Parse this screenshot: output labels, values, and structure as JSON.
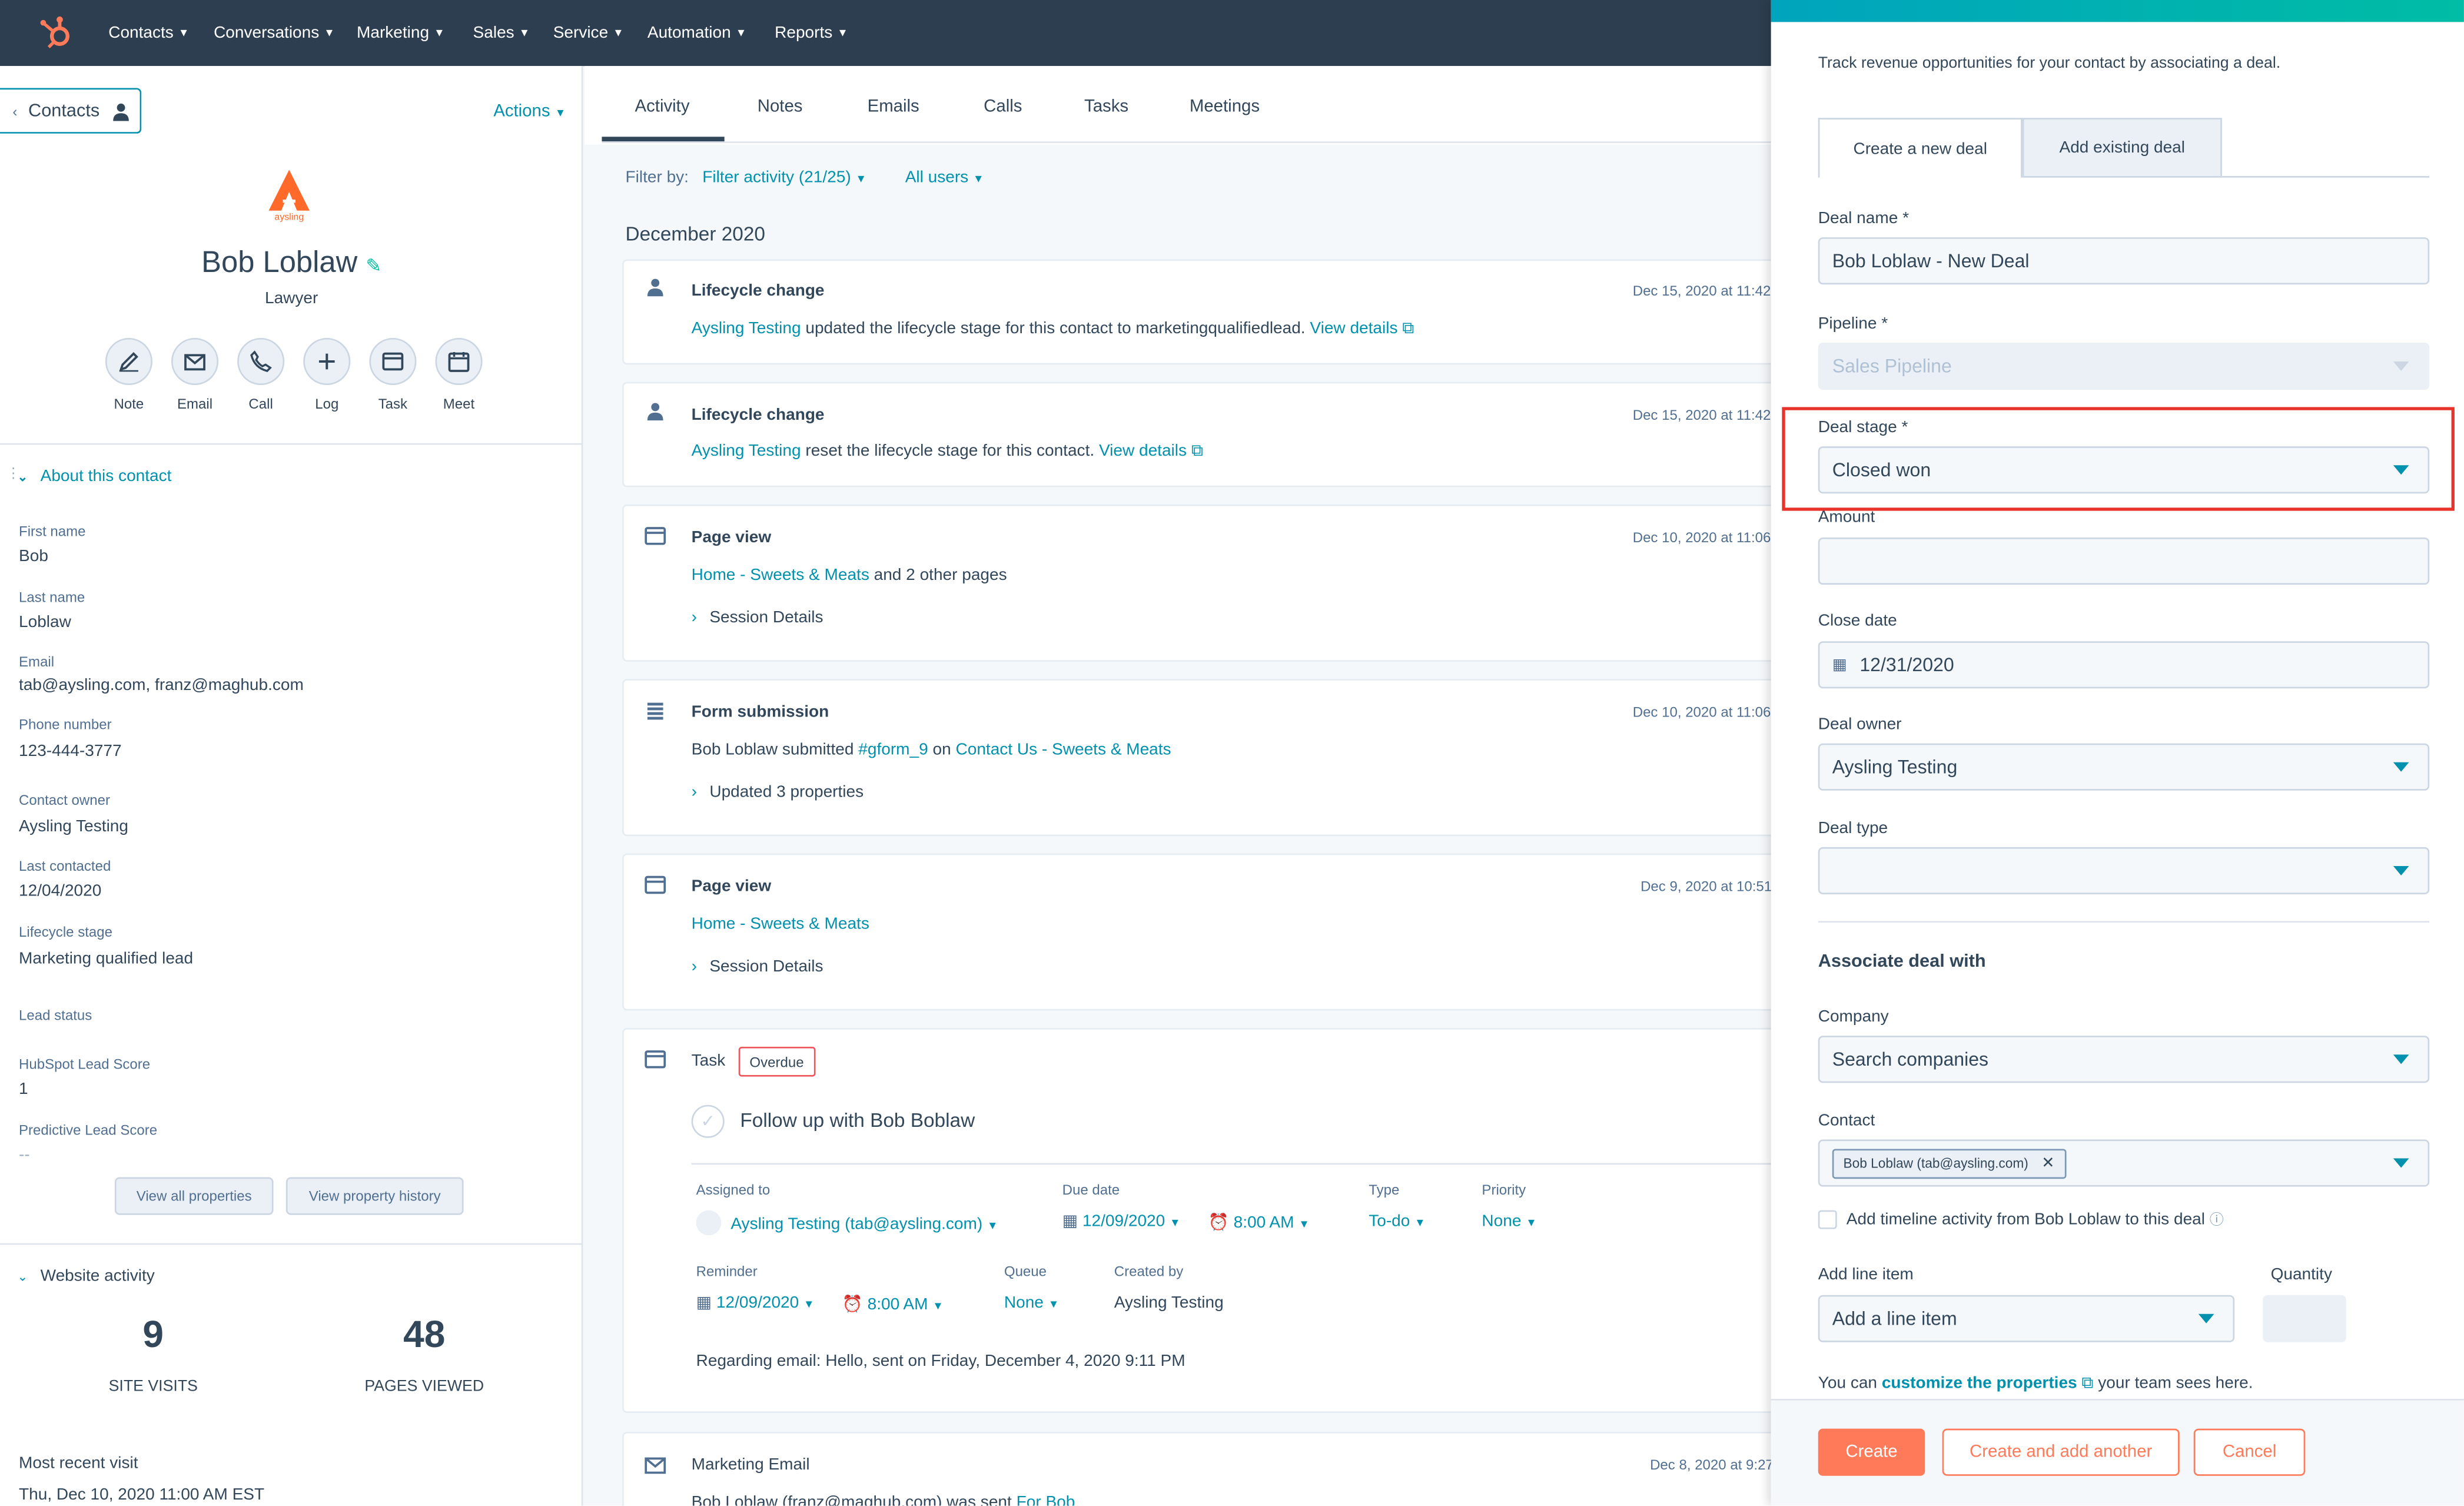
{
  "nav": {
    "items": [
      "Contacts",
      "Conversations",
      "Marketing",
      "Sales",
      "Service",
      "Automation",
      "Reports"
    ]
  },
  "contact": {
    "back_label": "Contacts",
    "actions_label": "Actions",
    "company_logo_text": "aysling",
    "name": "Bob Loblaw",
    "title": "Lawyer",
    "quick_actions": [
      "Note",
      "Email",
      "Call",
      "Log",
      "Task",
      "Meet"
    ],
    "about_header": "About this contact",
    "properties": [
      {
        "label": "First name",
        "value": "Bob"
      },
      {
        "label": "Last name",
        "value": "Loblaw"
      },
      {
        "label": "Email",
        "value": "tab@aysling.com, franz@maghub.com"
      },
      {
        "label": "Phone number",
        "value": "123-444-3777"
      },
      {
        "label": "Contact owner",
        "value": "Aysling Testing"
      },
      {
        "label": "Last contacted",
        "value": "12/04/2020"
      },
      {
        "label": "Lifecycle stage",
        "value": "Marketing qualified lead"
      },
      {
        "label": "Lead status",
        "value": ""
      },
      {
        "label": "HubSpot Lead Score",
        "value": "1"
      },
      {
        "label": "Predictive Lead Score",
        "value": "--"
      }
    ],
    "view_all_label": "View all properties",
    "view_history_label": "View property history",
    "website_activity_header": "Website activity",
    "site_visits_value": "9",
    "site_visits_label": "SITE VISITS",
    "pages_viewed_value": "48",
    "pages_viewed_label": "PAGES VIEWED",
    "most_recent_label": "Most recent visit",
    "most_recent_value": "Thu, Dec 10, 2020 11:00 AM EST"
  },
  "timeline": {
    "tabs": [
      "Activity",
      "Notes",
      "Emails",
      "Calls",
      "Tasks",
      "Meetings"
    ],
    "filter_label": "Filter by:",
    "filter_activity": "Filter activity (21/25)",
    "filter_users": "All users",
    "month": "December 2020",
    "c1": {
      "title": "Lifecycle change",
      "date": "Dec 15, 2020 at 11:42",
      "link": "Aysling Testing",
      "text": "updated the lifecycle stage for this contact to marketingqualifiedlead.",
      "details": "View details"
    },
    "c2": {
      "title": "Lifecycle change",
      "date": "Dec 15, 2020 at 11:42",
      "link": "Aysling Testing",
      "text": "reset the lifecycle stage for this contact.",
      "details": "View details"
    },
    "c3": {
      "title": "Page view",
      "date": "Dec 10, 2020 at 11:06",
      "link": "Home - Sweets & Meats",
      "text": "and 2 other pages",
      "session": "Session Details"
    },
    "c4": {
      "title": "Form submission",
      "date": "Dec 10, 2020 at 11:06",
      "text1": "Bob Loblaw submitted",
      "link1": "#gform_9",
      "text2": "on",
      "link2": "Contact Us - Sweets & Meats",
      "updated": "Updated 3 properties"
    },
    "c5": {
      "title": "Page view",
      "date": "Dec 9, 2020 at 10:51",
      "link": "Home - Sweets & Meats",
      "session": "Session Details"
    },
    "c6": {
      "title": "Task",
      "badge": "Overdue",
      "task_name": "Follow up with Bob Boblaw",
      "assigned_label": "Assigned to",
      "assigned_value": "Aysling Testing (tab@aysling.com)",
      "due_label": "Due date",
      "due_date": "12/09/2020",
      "due_time": "8:00 AM",
      "type_label": "Type",
      "type_value": "To-do",
      "priority_label": "Priority",
      "priority_value": "None",
      "reminder_label": "Reminder",
      "reminder_date": "12/09/2020",
      "reminder_time": "8:00 AM",
      "queue_label": "Queue",
      "queue_value": "None",
      "created_label": "Created by",
      "created_value": "Aysling Testing",
      "regarding": "Regarding email: Hello, sent on Friday, December 4, 2020 9:11 PM"
    },
    "c7": {
      "title": "Marketing Email",
      "date": "Dec 8, 2020 at 9:27",
      "text": "Bob Loblaw (franz@maghub.com) was sent",
      "link": "For Bob"
    }
  },
  "deal_panel": {
    "intro": "Track revenue opportunities for your contact by associating a deal.",
    "tab_new": "Create a new deal",
    "tab_existing": "Add existing deal",
    "deal_name_label": "Deal name *",
    "deal_name_value": "Bob Loblaw - New Deal",
    "pipeline_label": "Pipeline *",
    "pipeline_value": "Sales Pipeline",
    "stage_label": "Deal stage *",
    "stage_value": "Closed won",
    "amount_label": "Amount",
    "amount_value": "",
    "close_label": "Close date",
    "close_value": "12/31/2020",
    "owner_label": "Deal owner",
    "owner_value": "Aysling Testing",
    "type_label": "Deal type",
    "type_value": "",
    "associate_header": "Associate deal with",
    "company_label": "Company",
    "company_value": "Search companies",
    "contact_label": "Contact",
    "contact_chip": "Bob Loblaw (tab@aysling.com)",
    "timeline_checkbox": "Add timeline activity from Bob Loblaw to this deal",
    "line_item_label": "Add line item",
    "line_item_value": "Add a line item",
    "quantity_label": "Quantity",
    "customize_pre": "You can",
    "customize_link": "customize the properties",
    "customize_post": "your team sees here.",
    "create": "Create",
    "create_another": "Create and add another",
    "cancel": "Cancel"
  },
  "colors": {
    "accent": "#0091ae",
    "primary_button": "#ff7a59",
    "highlight_box": "#e8332a",
    "nav_bg": "#2d3e50"
  }
}
